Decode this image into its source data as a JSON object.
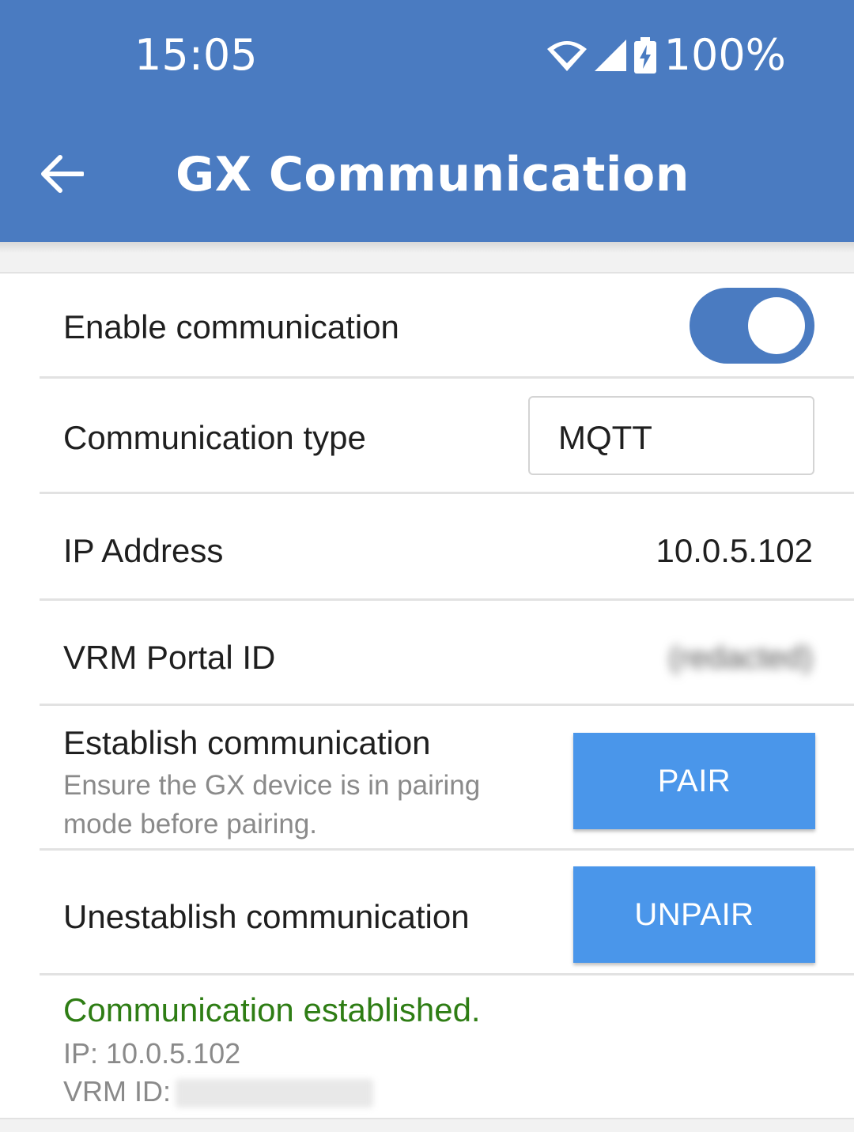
{
  "status_bar": {
    "time": "15:05",
    "battery": "100%"
  },
  "header": {
    "title": "GX Communication"
  },
  "settings": {
    "enable_label": "Enable communication",
    "enable_on": true,
    "type_label": "Communication type",
    "type_value": "MQTT",
    "ip_label": "IP Address",
    "ip_value": "10.0.5.102",
    "vrm_label": "VRM Portal ID",
    "vrm_value": "(redacted)",
    "establish_label": "Establish communication",
    "establish_desc": "Ensure the GX device is in pairing mode before pairing.",
    "pair_button": "PAIR",
    "unestablish_label": "Unestablish communication",
    "unpair_button": "UNPAIR"
  },
  "connection_status": {
    "message": "Communication established.",
    "ip_line": "IP: 10.0.5.102",
    "vrm_line_label": "VRM ID:"
  },
  "colors": {
    "header_bg": "#4a7bc1",
    "button_bg": "#4a96ea",
    "success_text": "#2e7d14"
  }
}
